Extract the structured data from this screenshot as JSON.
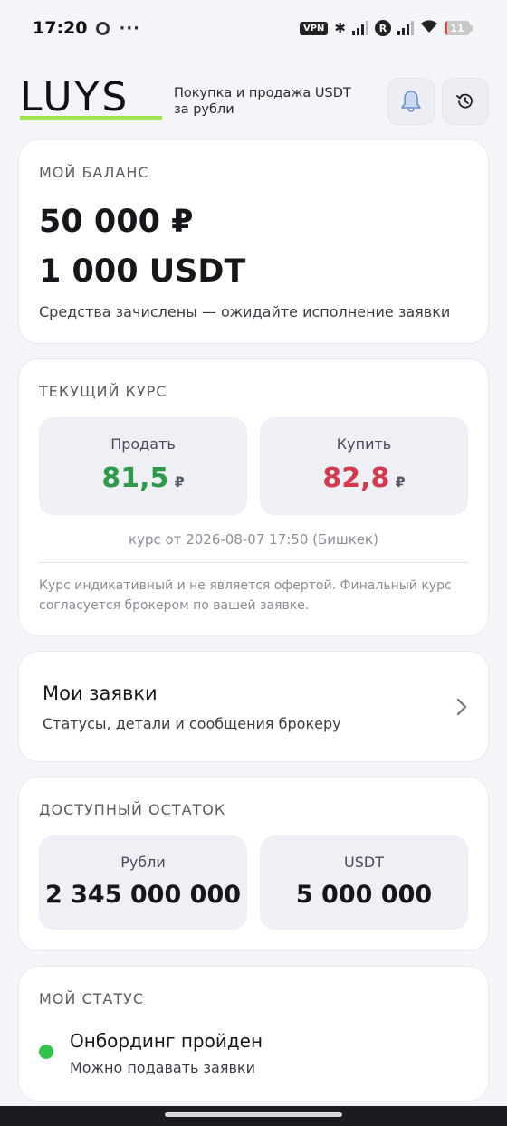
{
  "status_bar": {
    "time": "17:20",
    "more": "···",
    "vpn": "VPN",
    "roaming_badge": "R",
    "battery_level": "11",
    "battery_fraction": 0.11,
    "icons": [
      "chrome-icon",
      "bluetooth-icon",
      "signal-icon",
      "wifi-icon",
      "battery-icon"
    ]
  },
  "header": {
    "logo_text": "LUYS",
    "tagline": "Покупка и продажа USDT за рубли",
    "bell_icon": "bell-icon",
    "history_icon": "history-icon",
    "accent_color": "#9fe24a"
  },
  "balance": {
    "title": "МОЙ БАЛАНС",
    "rub": "50 000 ₽",
    "usdt": "1 000 USDT",
    "note": "Средства зачислены — ожидайте исполнение заявки"
  },
  "rate": {
    "title": "ТЕКУЩИЙ КУРС",
    "sell_label": "Продать",
    "sell_value": "81,5",
    "sell_currency": "₽",
    "buy_label": "Купить",
    "buy_value": "82,8",
    "buy_currency": "₽",
    "timestamp": "курс от 2026-08-07 17:50 (Бишкек)",
    "disclaimer": "Курс индикативный и не является офертой. Финальный курс согласуется брокером по вашей заявке.",
    "sell_color": "#2e9b4a",
    "buy_color": "#d33a4d"
  },
  "orders": {
    "title": "Мои заявки",
    "subtitle": "Статусы, детали и сообщения брокеру",
    "chevron_icon": "chevron-right-icon"
  },
  "remain": {
    "title": "ДОСТУПНЫЙ ОСТАТОК",
    "rub_label": "Рубли",
    "rub_value": "2 345 000 000",
    "usdt_label": "USDT",
    "usdt_value": "5 000 000"
  },
  "status": {
    "title": "МОЙ СТАТУС",
    "headline": "Онбординг пройден",
    "subtitle": "Можно подавать заявки",
    "dot_color": "#33c24a"
  }
}
